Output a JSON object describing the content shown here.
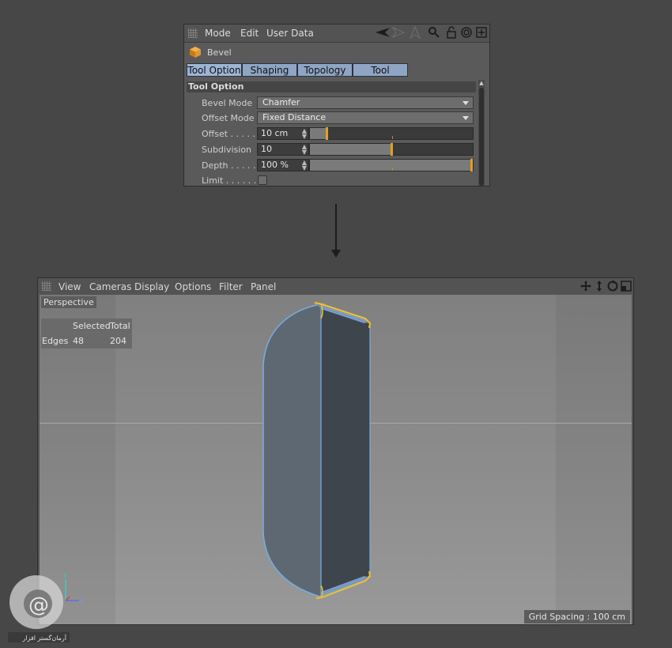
{
  "panel": {
    "menu": [
      "Mode",
      "Edit",
      "User Data"
    ],
    "title": "Bevel",
    "tabs": [
      "Tool Option",
      "Shaping",
      "Topology",
      "Tool"
    ],
    "section": "Tool Option",
    "props": {
      "bevel_mode_label": "Bevel Mode",
      "bevel_mode_value": "Chamfer",
      "offset_mode_label": "Offset Mode",
      "offset_mode_value": "Fixed Distance",
      "offset_label": "Offset . . . . . .",
      "offset_value": "10 cm",
      "offset_slider": 0.1,
      "subdivision_label": "Subdivision",
      "subdivision_value": "10",
      "subdivision_slider": 0.5,
      "depth_label": "Depth . . . . . .",
      "depth_value": "100 %",
      "depth_slider": 1.0,
      "limit_label": "Limit . . . . . . ."
    }
  },
  "viewport": {
    "menu": [
      "View",
      "Cameras",
      "Display",
      "Options",
      "Filter",
      "Panel"
    ],
    "camera": "Perspective",
    "hud": {
      "col_selected": "Selected",
      "col_total": "Total",
      "row_label": "Edges",
      "selected": "48",
      "total": "204"
    },
    "grid_spacing": "Grid Spacing : 100 cm",
    "axis": {
      "y": "Y",
      "z": "Z"
    }
  },
  "colors": {
    "tab": "#8fa5c4",
    "slider_knob": "#e3a022",
    "selection_edge": "#f2c028",
    "object_edge": "#6fa8dc"
  },
  "watermark": "آرمان‌گستر افزار"
}
